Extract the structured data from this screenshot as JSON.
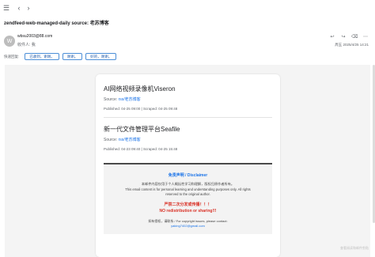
{
  "nav": {
    "menu_icon": "☰",
    "back_icon": "‹",
    "forward_icon": "›"
  },
  "subject": "zendfeed-web-managed-daily  source: 老苏博客",
  "header": {
    "avatar_letter": "W",
    "sender": "wbsu2003@88.com",
    "recipient": "收件人: 我",
    "actions": [
      "↩",
      "↪",
      "⌫",
      "⋯"
    ],
    "datetime": "周五 2025/4/25 14:21"
  },
  "quickbar": {
    "label": "快速回复:",
    "chips": [
      "已收到，谢谢。",
      "谢谢。",
      "好的，谢谢。"
    ]
  },
  "articles": [
    {
      "title": "AI网络视频录像机Viseron",
      "source_label": "Source: ",
      "source_link": "rss/老苏博客",
      "published": "Published: 04-25 09:00 | Scraped: 04-25 09:48"
    },
    {
      "title": "新一代文件管理平台Seafile",
      "source_label": "Source: ",
      "source_link": "rss/老苏博客",
      "published": "Published: 04-23 09:40 | Scraped: 04-25 15:48"
    }
  ],
  "disclaimer": {
    "title": "免责声明 / Disclaimer",
    "cn": "本邮件内容仅用于个人概括性学习和理解，版权归原作者所有。",
    "en1": "This email content is for personal learning and understanding purposes only. All rights",
    "en2": "reserved to the original author.",
    "warn_cn": "严禁二次分发或传播！！！",
    "warn_en": "NO redistribution or sharing!!!",
    "contact1": "如有侵权，请联系 / For copyright issues, please contact:",
    "contact2": "yaking7402@gmail.com"
  },
  "watermark": "查看阅读和邮件剪贴"
}
